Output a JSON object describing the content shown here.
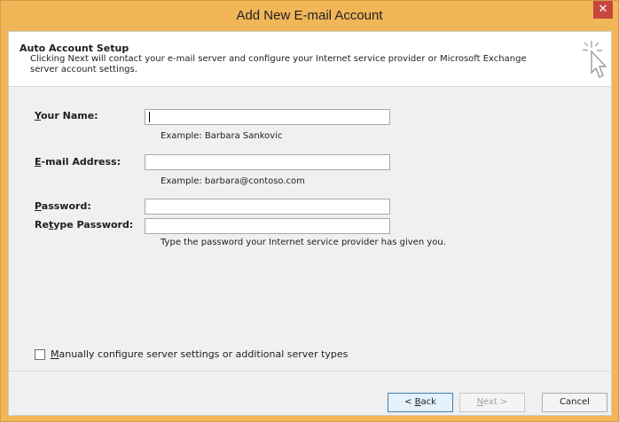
{
  "window": {
    "title": "Add New E-mail Account",
    "close_glyph": "✕"
  },
  "header": {
    "title": "Auto Account Setup",
    "description": "Clicking Next will contact your e-mail server and configure your Internet service provider or Microsoft Exchange server account settings.",
    "icon": "wizard-cursor-icon"
  },
  "form": {
    "name": {
      "label_underlined": "Y",
      "label_rest": "our Name:",
      "value": "",
      "example": "Example: Barbara Sankovic"
    },
    "email": {
      "label_underlined": "E",
      "label_rest": "-mail Address:",
      "value": "",
      "example": "Example: barbara@contoso.com"
    },
    "password": {
      "label_underlined": "P",
      "label_rest": "assword:",
      "value": ""
    },
    "retype": {
      "label_pre": "Re",
      "label_underlined": "t",
      "label_rest": "ype Password:",
      "value": "",
      "hint": "Type the password your Internet service provider has given you."
    }
  },
  "manual_config": {
    "checked": false,
    "label_underlined": "M",
    "label_rest": "anually configure server settings or additional server types"
  },
  "buttons": {
    "back_pre": "< ",
    "back_underlined": "B",
    "back_rest": "ack",
    "next_underlined": "N",
    "next_rest": "ext >",
    "cancel": "Cancel"
  },
  "colors": {
    "title_bar": "#f1b658",
    "close_button": "#c9463d",
    "dialog_body": "#f0f0f0"
  }
}
